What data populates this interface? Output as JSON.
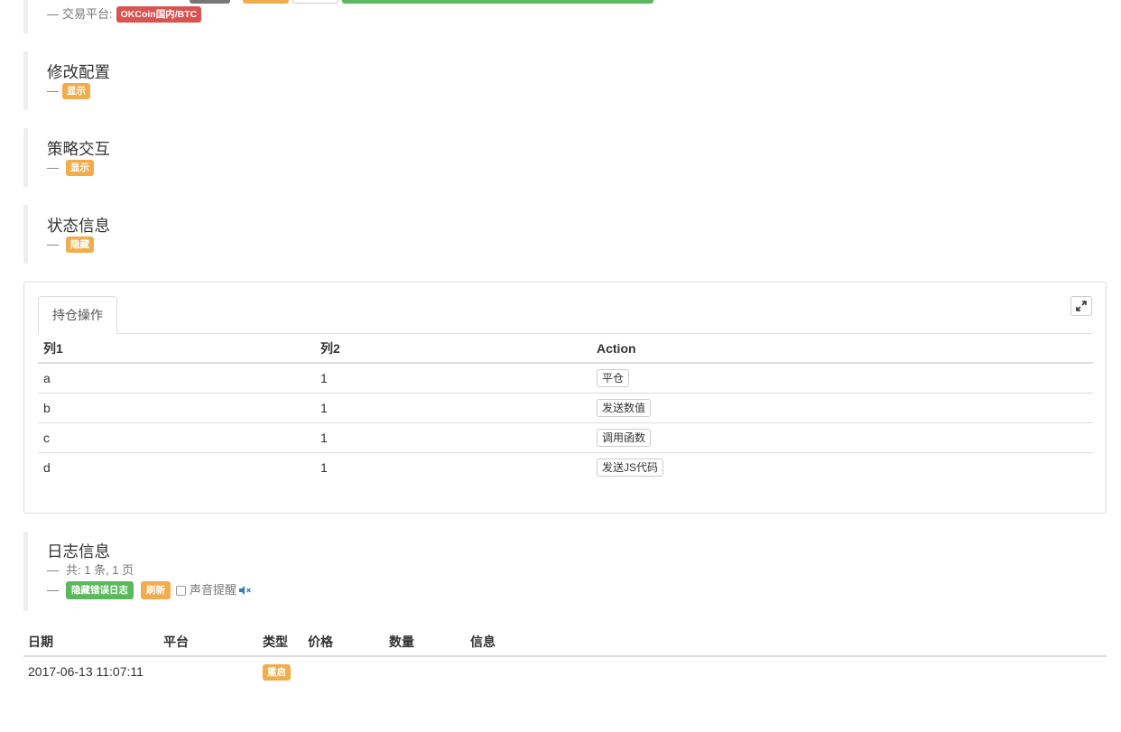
{
  "exchange_section": {
    "label": "交易平台:",
    "platform_badge": "OKCoin国内/BTC"
  },
  "config_section": {
    "title": "修改配置",
    "toggle_label": "显示"
  },
  "interaction_section": {
    "title": "策略交互",
    "toggle_label": "显示"
  },
  "status_section": {
    "title": "状态信息",
    "toggle_label": "隐藏"
  },
  "position_panel": {
    "tab_label": "持仓操作",
    "columns": [
      "列1",
      "列2",
      "Action"
    ],
    "rows": [
      {
        "c1": "a",
        "c2": "1",
        "action": "平仓"
      },
      {
        "c1": "b",
        "c2": "1",
        "action": "发送数值"
      },
      {
        "c1": "c",
        "c2": "1",
        "action": "调用函数"
      },
      {
        "c1": "d",
        "c2": "1",
        "action": "发送JS代码"
      }
    ]
  },
  "log_section": {
    "title": "日志信息",
    "summary": "共: 1 条, 1 页",
    "hide_errors_label": "隐藏错误日志",
    "refresh_label": "刷新",
    "sound_label": "声音提醒",
    "columns": [
      "日期",
      "平台",
      "类型",
      "价格",
      "数量",
      "信息"
    ],
    "rows": [
      {
        "date": "2017-06-13 11:07:11",
        "platform": "",
        "type": "重启",
        "price": "",
        "amount": "",
        "info": ""
      }
    ]
  },
  "colors": {
    "warning": "#f0ad4e",
    "danger": "#d9534f",
    "success": "#5cb85c",
    "muted_text": "#777777",
    "border": "#dddddd"
  }
}
